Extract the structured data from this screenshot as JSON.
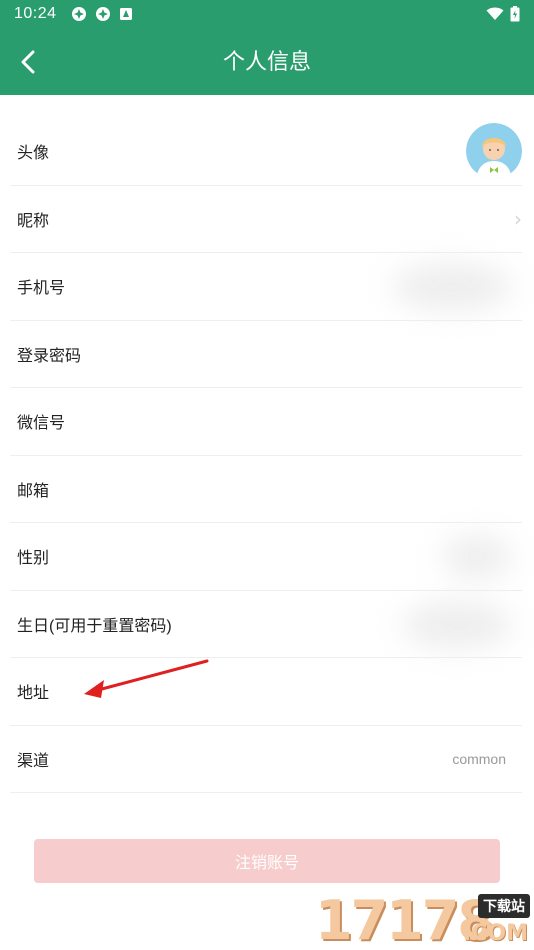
{
  "status_bar": {
    "time": "10:24",
    "left_icons": [
      "notification-icon",
      "notification-icon",
      "app-notification-icon"
    ],
    "right_icons": [
      "wifi-icon",
      "battery-icon"
    ]
  },
  "header": {
    "title": "个人信息",
    "back_icon": "back-arrow-icon",
    "background": "#2a9d6e"
  },
  "rows": [
    {
      "label": "头像",
      "value": "",
      "kind": "avatar"
    },
    {
      "label": "昵称",
      "value": "",
      "kind": "chevron"
    },
    {
      "label": "手机号",
      "value": "",
      "kind": "blurred"
    },
    {
      "label": "登录密码",
      "value": "",
      "kind": "plain"
    },
    {
      "label": "微信号",
      "value": "",
      "kind": "plain"
    },
    {
      "label": "邮箱",
      "value": "",
      "kind": "plain"
    },
    {
      "label": "性别",
      "value": "",
      "kind": "blurred"
    },
    {
      "label": "生日(可用于重置密码)",
      "value": "",
      "kind": "blurred"
    },
    {
      "label": "地址",
      "value": "",
      "kind": "plain"
    },
    {
      "label": "渠道",
      "value": "common",
      "kind": "text"
    }
  ],
  "cancel_button": {
    "label": "注销账号",
    "color": "#f7cccc"
  },
  "watermark": {
    "number": "17178",
    "tag": "下载站",
    "suffix": ".COM"
  }
}
